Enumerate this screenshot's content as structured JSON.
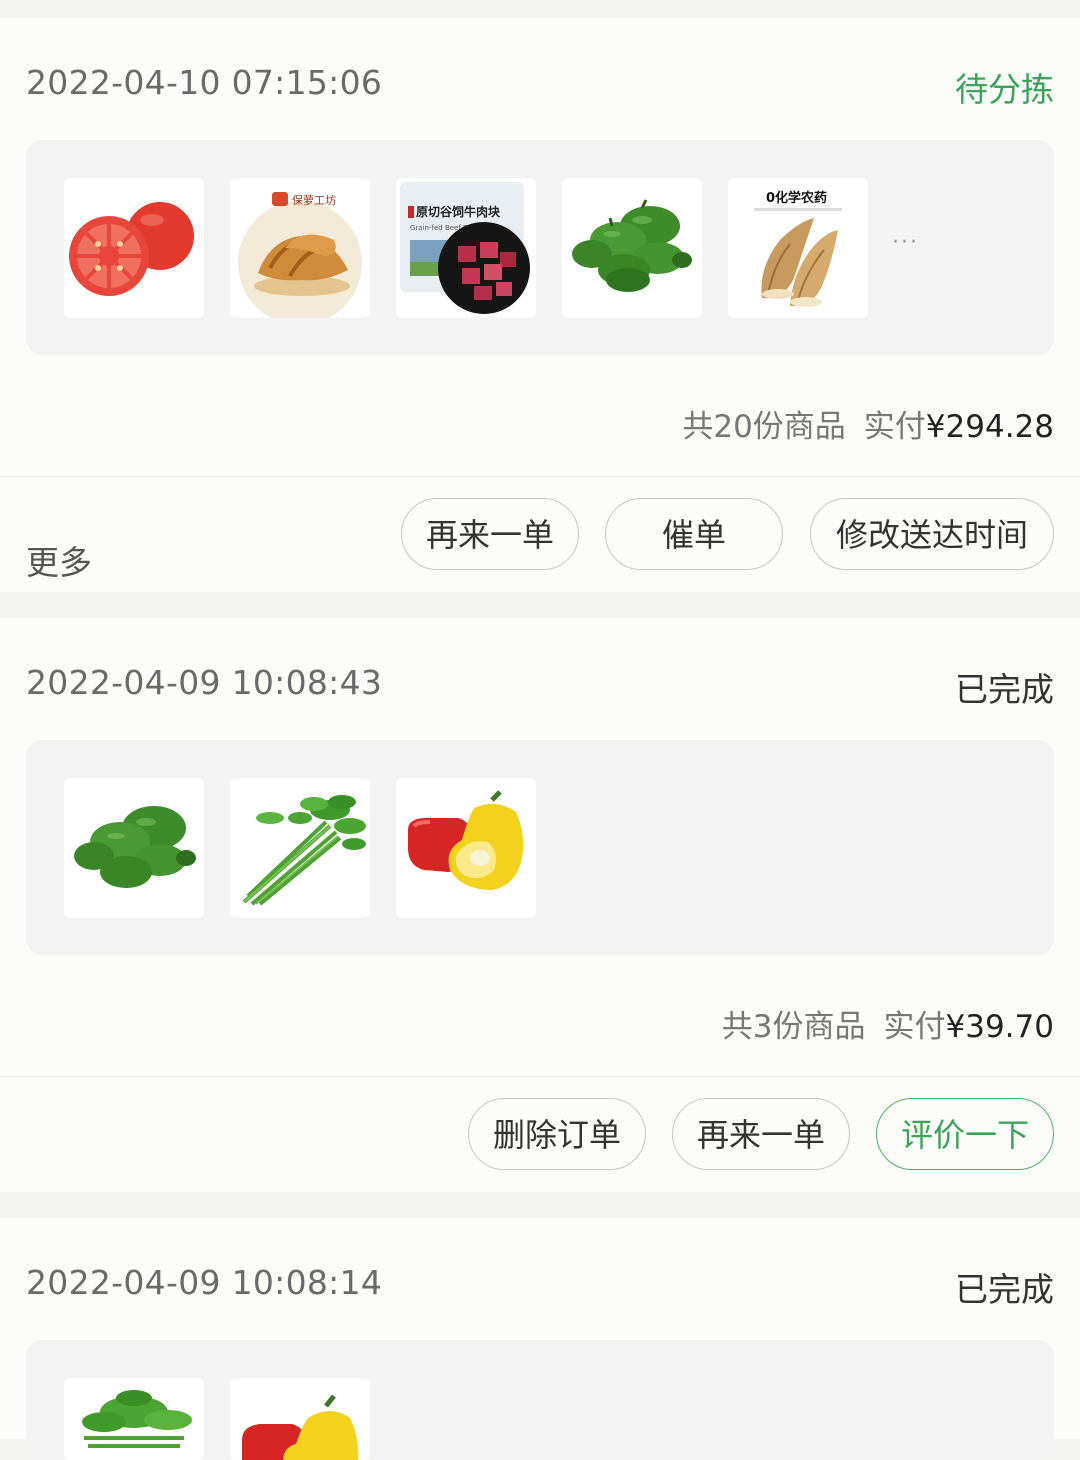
{
  "orders": [
    {
      "datetime": "2022-04-10 07:15:06",
      "status": "待分拣",
      "items": [
        "tomato",
        "croissant",
        "beef-cubes",
        "green-peppers",
        "bamboo-shoots"
      ],
      "product_texts": {
        "bakery_brand": "保萝工坊",
        "beef_label": "原切谷饲牛肉块",
        "beef_sub": "Grain-fed Beef Diced",
        "bamboo_label": "0化学农药"
      },
      "has_more": true,
      "more_indicator": "···",
      "count_text": "共20份商品",
      "paid_label": "实付",
      "paid_amount": "¥294.28",
      "more_link": "更多",
      "buttons": [
        "再来一单",
        "催单",
        "修改送达时间"
      ]
    },
    {
      "datetime": "2022-04-09 10:08:43",
      "status": "已完成",
      "items": [
        "green-peppers",
        "water-spinach",
        "bell-peppers"
      ],
      "count_text": "共3份商品",
      "paid_label": "实付",
      "paid_amount": "¥39.70",
      "buttons": [
        "删除订单",
        "再来一单",
        "评价一下"
      ]
    },
    {
      "datetime": "2022-04-09 10:08:14",
      "status": "已完成",
      "items": [
        "water-spinach",
        "bell-peppers"
      ]
    }
  ],
  "colors": {
    "status_pending": "#3aa55a",
    "accent_button": "#3aa55a",
    "page_bg": "#f4f4f3"
  }
}
